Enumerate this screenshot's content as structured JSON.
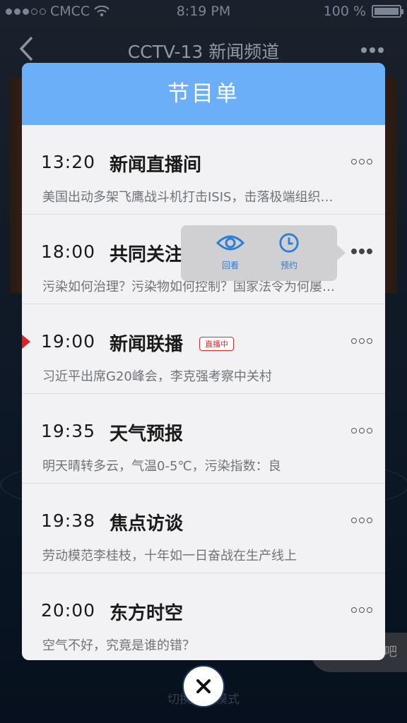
{
  "status_bar": {
    "carrier": "CMCC",
    "time": "8:19 PM",
    "battery": "100 %",
    "battery_level": 1.0
  },
  "nav": {
    "back_icon": "chevron-left-icon",
    "title": "CCTV-13 新闻频道",
    "more_icon": "more-dots-icon"
  },
  "modal": {
    "title": "节目单",
    "programs": [
      {
        "time": "13:20",
        "title": "新闻直播间",
        "desc": "美国出动多架飞鹰战斗机打击ISIS，击落极端组织…",
        "live": false
      },
      {
        "time": "18:00",
        "title": "共同关注",
        "desc": "污染如何治理？污染物如何控制？国家法令为何屡…",
        "live": false
      },
      {
        "time": "19:00",
        "title": "新闻联播",
        "desc": "习近平出席G20峰会，李克强考察中关村",
        "live": true,
        "badge": "直播中"
      },
      {
        "time": "19:35",
        "title": "天气预报",
        "desc": "明天晴转多云，气温0-5℃，污染指数：良",
        "live": false
      },
      {
        "time": "19:38",
        "title": "焦点访谈",
        "desc": "劳动模范李桂枝，十年如一日奋战在生产线上",
        "live": false
      },
      {
        "time": "20:00",
        "title": "东方时空",
        "desc": "空气不好，究竟是谁的错？",
        "live": false
      }
    ],
    "popover": {
      "replay_label": "回看",
      "reserve_label": "预约"
    }
  },
  "background": {
    "chat_hint": "吧",
    "footer_hint": "切换为…模式"
  },
  "colors": {
    "header_blue": "#6aaff8",
    "live_red": "#e52a2a",
    "popover_icon_blue": "#2b7fd6"
  }
}
